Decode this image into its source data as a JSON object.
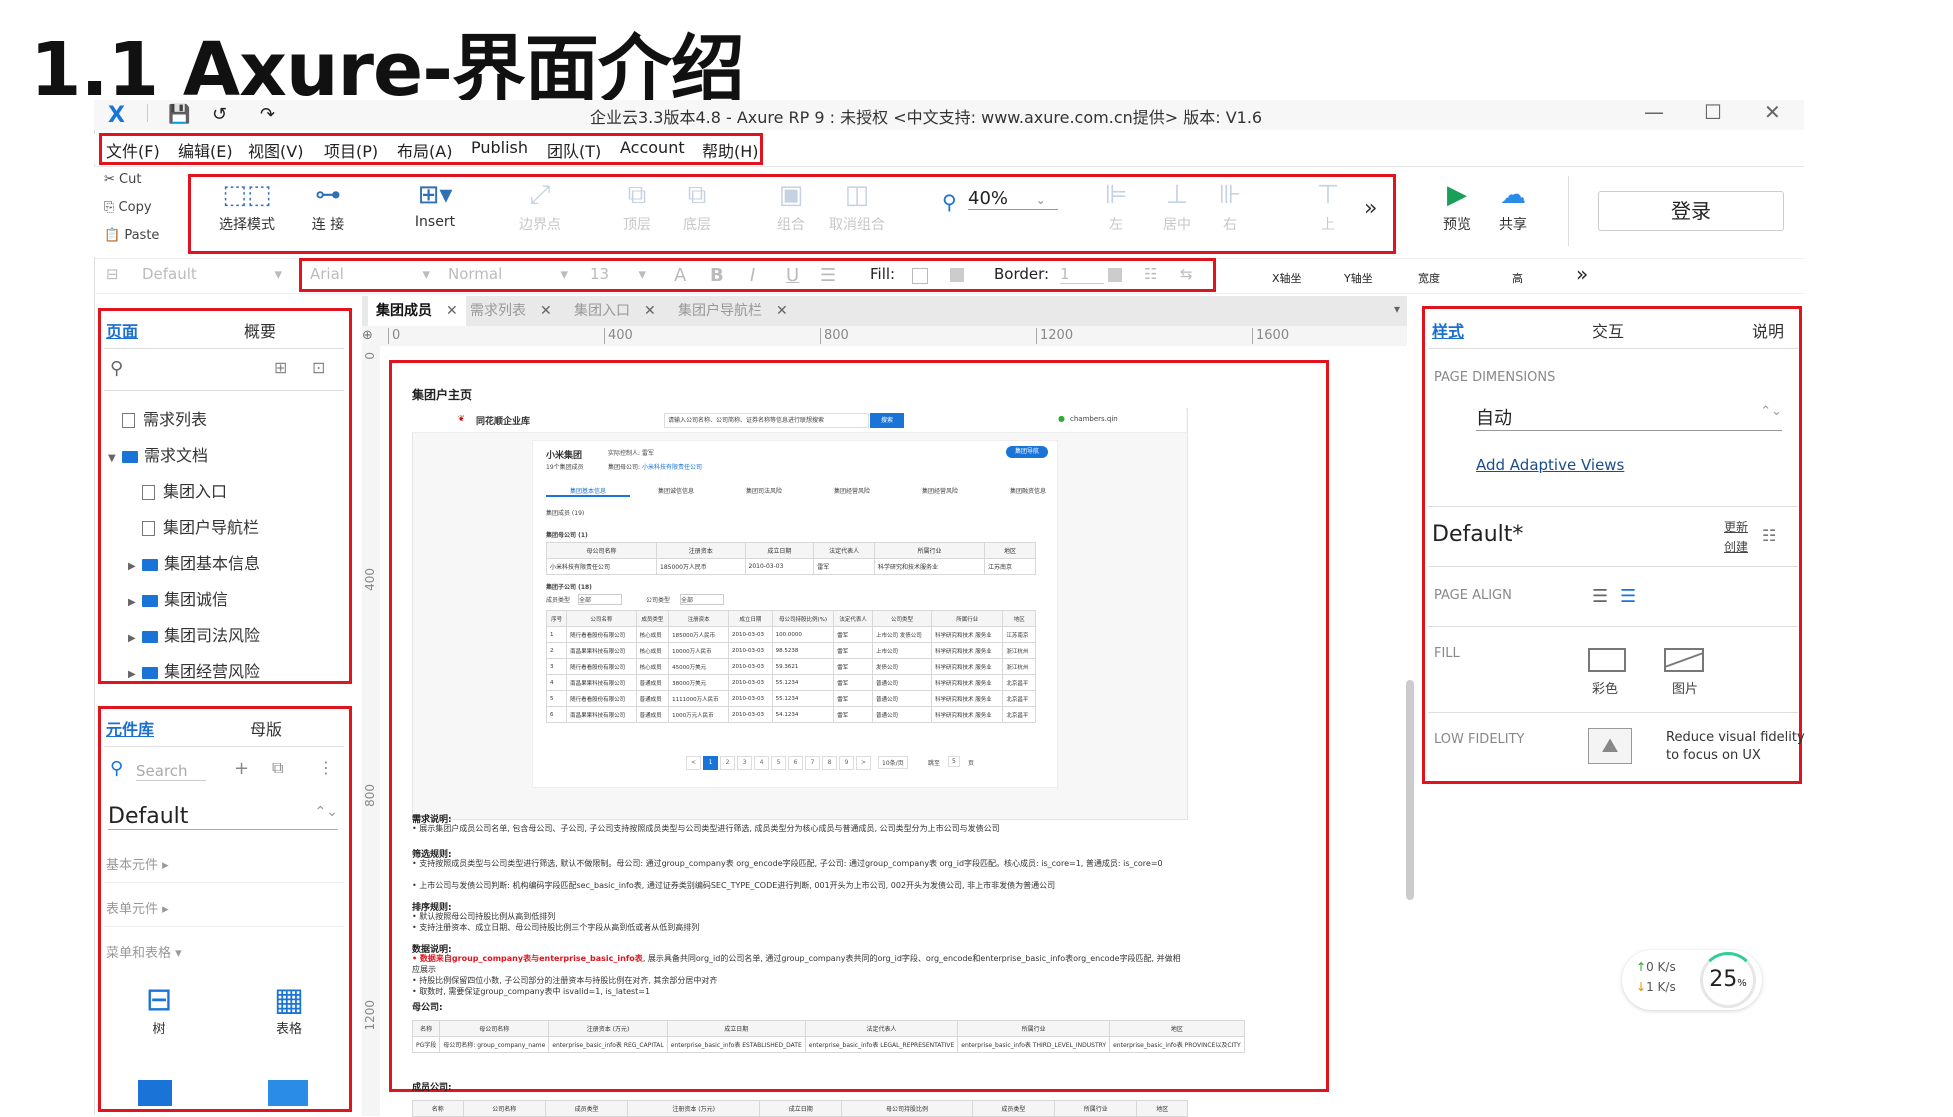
{
  "slide_title": "1.1 Axure-界面介绍",
  "window": {
    "title": "企业云3.3版本4.8 - Axure RP 9 : 未授权    <中文支持: www.axure.com.cn提供> 版本: V1.6",
    "minimize": "—",
    "maximize": "☐",
    "close": "✕"
  },
  "menu": [
    "文件(F)",
    "编辑(E)",
    "视图(V)",
    "项目(P)",
    "布局(A)",
    "Publish",
    "团队(T)",
    "Account",
    "帮助(H)"
  ],
  "clipboard": {
    "cut": "Cut",
    "copy": "Copy",
    "paste": "Paste"
  },
  "toolbar": {
    "select_mode": "选择模式",
    "connect": "连 接",
    "insert": "Insert",
    "endpoint": "边界点",
    "top": "顶层",
    "bottom": "底层",
    "group": "组合",
    "ungroup": "取消组合",
    "zoom": "40%",
    "left": "左",
    "center": "居中",
    "right": "右",
    "up": "上",
    "more": "»",
    "preview": "预览",
    "share": "共享",
    "login": "登录"
  },
  "format": {
    "style": "Default",
    "font": "Arial",
    "weight": "Normal",
    "size": "13",
    "fill": "Fill:",
    "border": "Border:",
    "border_val": "1",
    "x": "X轴坐",
    "y": "Y轴坐",
    "w": "宽度",
    "h": "高",
    "more": "»"
  },
  "pages_panel": {
    "tab_pages": "页面",
    "tab_outline": "概要",
    "items": [
      {
        "label": "需求列表",
        "type": "page",
        "indent": 0
      },
      {
        "label": "需求文档",
        "type": "folder-open",
        "indent": 0
      },
      {
        "label": "集团入口",
        "type": "page",
        "indent": 1
      },
      {
        "label": "集团户导航栏",
        "type": "page",
        "indent": 1
      },
      {
        "label": "集团基本信息",
        "type": "folder",
        "indent": 1
      },
      {
        "label": "集团诚信",
        "type": "folder",
        "indent": 1
      },
      {
        "label": "集团司法风险",
        "type": "folder",
        "indent": 1
      },
      {
        "label": "集团经营风险",
        "type": "folder",
        "indent": 1
      }
    ]
  },
  "library_panel": {
    "tab_library": "元件库",
    "tab_masters": "母版",
    "search_placeholder": "Search",
    "library": "Default",
    "groups": [
      "基本元件 ▸",
      "表单元件 ▸",
      "菜单和表格 ▾"
    ],
    "widgets": [
      "树",
      "表格"
    ]
  },
  "tabs": [
    "集团成员",
    "需求列表",
    "集团入口",
    "集团户导航栏"
  ],
  "ruler": {
    "h": [
      "0",
      "400",
      "800",
      "1200",
      "1600"
    ],
    "v": [
      "0",
      "400",
      "800",
      "1200"
    ]
  },
  "canvas": {
    "page_title": "集团户主页",
    "brand": "同花顺企业库",
    "search_hint": "请输入公司名称、公司简称、证券名称等信息进行联想搜索",
    "search_btn": "搜索",
    "user": "chambers.qin",
    "company": "小米集团",
    "members": "19个集团成员",
    "controller": "实际控制人: 雷军",
    "parent_co": "集团母公司:",
    "parent_link": "小米科技有限责任公司",
    "nav_btn": "集团导航",
    "subtabs": [
      "集团基本信息",
      "集团诚信信息",
      "集团司法风险",
      "集团经营风险",
      "集团经营风险",
      "集团融资信息"
    ],
    "members_title": "集团成员 (19)",
    "parent_title": "集团母公司 (1)",
    "parent_headers": [
      "母公司名称",
      "注册资本",
      "成立日期",
      "法定代表人",
      "所属行业",
      "地区"
    ],
    "parent_row": [
      "小米科技有限责任公司",
      "185000万人民币",
      "2010-03-03",
      "雷军",
      "科学研究和技术服务业",
      "江苏南京"
    ],
    "sub_title": "集团子公司 (18)",
    "filter_type": "成员类型",
    "filter_type_val": "全部",
    "filter_co": "公司类型",
    "filter_co_val": "全部",
    "sub_headers": [
      "序号",
      "公司名称",
      "成员类型",
      "注册资本",
      "成立日期",
      "母公司持股比例(%)",
      "法定代表人",
      "公司类型",
      "所属行业",
      "地区"
    ],
    "sub_rows": [
      [
        "1",
        "随行看看股份有限公司",
        "核心成员",
        "185000万人民币",
        "2010-03-03",
        "100.0000",
        "雷军",
        "上市公司 发债公司",
        "科学研究和技术 服务业",
        "江苏南京"
      ],
      [
        "2",
        "南昌果果科技有限公司",
        "核心成员",
        "10000万人民币",
        "2010-03-03",
        "98.5238",
        "雷军",
        "上市公司",
        "科学研究和技术 服务业",
        "浙江杭州"
      ],
      [
        "3",
        "随行看看股份有限公司",
        "核心成员",
        "45000万美元",
        "2010-03-03",
        "59.3621",
        "雷军",
        "发债公司",
        "科学研究和技术 服务业",
        "浙江杭州"
      ],
      [
        "4",
        "南昌果果科技有限公司",
        "普通成员",
        "38000万美元",
        "2010-03-03",
        "55.1234",
        "雷军",
        "普通公司",
        "科学研究和技术 服务业",
        "北京昌平"
      ],
      [
        "5",
        "随行看看股份有限公司",
        "普通成员",
        "1111000万人民币",
        "2010-03-03",
        "55.1234",
        "雷军",
        "普通公司",
        "科学研究和技术 服务业",
        "北京昌平"
      ],
      [
        "6",
        "南昌果果科技有限公司",
        "普通成员",
        "1000万元人民币",
        "2010-03-03",
        "54.1234",
        "雷军",
        "普通公司",
        "科学研究和技术 服务业",
        "北京昌平"
      ]
    ],
    "pager": [
      "<",
      "1",
      "2",
      "3",
      "4",
      "5",
      "6",
      "7",
      "8",
      "9",
      ">"
    ],
    "pager_size": "10条/页",
    "pager_goto": "跳至",
    "pager_goto_val": "5",
    "pager_page": "页",
    "req_title": "需求说明:",
    "req_body": "• 展示集团户成员公司名单, 包含母公司、子公司, 子公司支持按照成员类型与公司类型进行筛选, 成员类型分为核心成员与普通成员, 公司类型分为上市公司与发债公司",
    "filter_rule_title": "筛选规则:",
    "filter_rule_1": "• 支持按照成员类型与公司类型进行筛选, 默认不做限制。母公司: 通过group_company表 org_encode字段匹配, 子公司: 通过group_company表 org_id字段匹配。核心成员: is_core=1, 普通成员: is_core=0",
    "filter_rule_2": "• 上市公司与发债公司判断: 机构编码字段匹配sec_basic_info表, 通过证券类别编码SEC_TYPE_CODE进行判断, 001开头为上市公司, 002开头为发债公司, 非上市非发债为普通公司",
    "sort_title": "排序规则:",
    "sort_1": "• 默认按照母公司持股比例从高到低排列",
    "sort_2": "• 支持注册资本、成立日期、母公司持股比例三个字段从高到低或者从低到高排列",
    "data_title": "数据说明:",
    "data_red": "• 数据来自group_company表与enterprise_basic_info表",
    "data_1": ", 展示具备共同org_id的公司名单, 通过group_company表共同的org_id字段、org_encode和enterprise_basic_info表org_encode字段匹配, 并做相应展示",
    "data_2": "• 持股比例保留四位小数, 子公司部分的注册资本与持股比例在对齐, 其余部分居中对齐",
    "data_3": "• 取数时, 需要保证group_company表中 isvalid=1, is_latest=1",
    "mother_title": "母公司:",
    "mother_headers": [
      "名称",
      "母公司名称",
      "注册资本 (万元)",
      "成立日期",
      "法定代表人",
      "所属行业",
      "地区"
    ],
    "mother_row": [
      "PG字段",
      "母公司名称: group_company_name",
      "enterprise_basic_info表 REG_CAPITAL",
      "enterprise_basic_info表 ESTABLISHED_DATE",
      "enterprise_basic_info表 LEGAL_REPRESENTATIVE",
      "enterprise_basic_info表 THIRD_LEVEL_INDUSTRY",
      "enterprise_basic_info表 PROVINCE以及CITY"
    ],
    "member_co_title": "成员公司:",
    "member_co_headers": [
      "名称",
      "公司名称",
      "成员类型",
      "注册资本 (万元)",
      "成立日期",
      "母公司持股比例",
      "成员类型",
      "所属行业",
      "地区"
    ]
  },
  "inspector": {
    "tab_style": "样式",
    "tab_interact": "交互",
    "tab_notes": "说明",
    "dimensions_label": "PAGE DIMENSIONS",
    "dimensions_val": "自动",
    "adaptive": "Add Adaptive Views",
    "style_name": "Default*",
    "update": "更新",
    "create": "创建",
    "align_label": "PAGE ALIGN",
    "fill_label": "FILL",
    "fill_color": "彩色",
    "fill_image": "图片",
    "lowfi_label": "LOW FIDELITY",
    "lowfi_text_1": "Reduce visual fidelity",
    "lowfi_text_2": "to focus on UX"
  },
  "netmon": {
    "up": "0",
    "down": "1",
    "unit": "K/s",
    "pct": "25",
    "pct_unit": "%"
  }
}
